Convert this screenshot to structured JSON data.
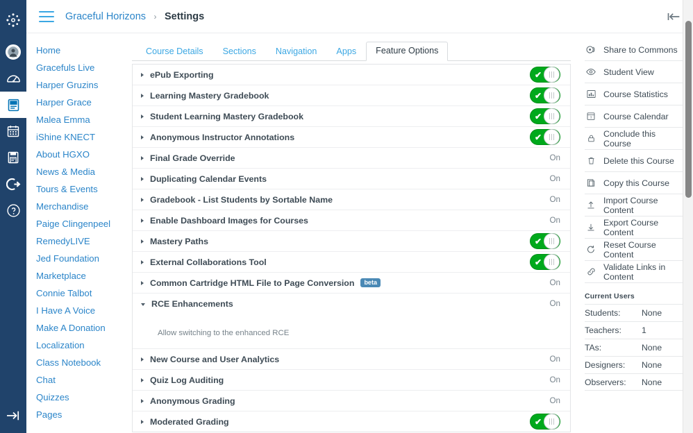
{
  "global_nav": {
    "items": [
      {
        "name": "canvas-logo",
        "icon": "canvas-logo-icon",
        "label": "Canvas",
        "active": false
      },
      {
        "name": "account",
        "icon": "avatar-icon",
        "label": "Account",
        "active": false
      },
      {
        "name": "dashboard",
        "icon": "dashboard-icon",
        "label": "Dashboard",
        "active": false
      },
      {
        "name": "courses",
        "icon": "courses-book-icon",
        "label": "Courses",
        "active": true
      },
      {
        "name": "calendar",
        "icon": "calendar-icon",
        "label": "Calendar",
        "active": false
      },
      {
        "name": "inbox",
        "icon": "inbox-icon",
        "label": "Inbox",
        "active": false
      },
      {
        "name": "logout",
        "icon": "logout-arrow-icon",
        "label": "Logout",
        "active": false
      },
      {
        "name": "help",
        "icon": "question-circle-icon",
        "label": "Help",
        "active": false
      }
    ],
    "bottom_item": {
      "name": "expand-nav",
      "icon": "arrow-to-right-icon",
      "label": "Expand navigation"
    }
  },
  "header": {
    "menu_icon": "hamburger-menu-icon",
    "breadcrumb": {
      "course": "Graceful Horizons",
      "separator": "›",
      "current": "Settings"
    },
    "collapse_icon": "collapse-panel-icon",
    "collapse_glyph": "|←"
  },
  "course_nav": {
    "items": [
      "Home",
      "Gracefuls Live",
      "Harper Gruzins",
      "Harper Grace",
      "Malea Emma",
      "iShine KNECT",
      "About HGXO",
      "News & Media",
      "Tours & Events",
      "Merchandise",
      "Paige Clingenpeel",
      "RemedyLIVE",
      "Jed Foundation",
      "Marketplace",
      "Connie Talbot",
      "I Have A Voice",
      "Make A Donation",
      "Localization",
      "Class Notebook",
      "Chat",
      "Quizzes",
      "Pages"
    ]
  },
  "tabs": [
    {
      "label": "Course Details",
      "active": false
    },
    {
      "label": "Sections",
      "active": false
    },
    {
      "label": "Navigation",
      "active": false
    },
    {
      "label": "Apps",
      "active": false
    },
    {
      "label": "Feature Options",
      "active": true
    }
  ],
  "features": [
    {
      "name": "ePub Exporting",
      "control": "toggle",
      "state": "on",
      "expanded": false,
      "beta": false
    },
    {
      "name": "Learning Mastery Gradebook",
      "control": "toggle",
      "state": "on",
      "expanded": false,
      "beta": false
    },
    {
      "name": "Student Learning Mastery Gradebook",
      "control": "toggle",
      "state": "on",
      "expanded": false,
      "beta": false
    },
    {
      "name": "Anonymous Instructor Annotations",
      "control": "toggle",
      "state": "on",
      "expanded": false,
      "beta": false
    },
    {
      "name": "Final Grade Override",
      "control": "text",
      "state": "On",
      "expanded": false,
      "beta": false
    },
    {
      "name": "Duplicating Calendar Events",
      "control": "text",
      "state": "On",
      "expanded": false,
      "beta": false
    },
    {
      "name": "Gradebook - List Students by Sortable Name",
      "control": "text",
      "state": "On",
      "expanded": false,
      "beta": false
    },
    {
      "name": "Enable Dashboard Images for Courses",
      "control": "text",
      "state": "On",
      "expanded": false,
      "beta": false
    },
    {
      "name": "Mastery Paths",
      "control": "toggle",
      "state": "on",
      "expanded": false,
      "beta": false
    },
    {
      "name": "External Collaborations Tool",
      "control": "toggle",
      "state": "on",
      "expanded": false,
      "beta": false
    },
    {
      "name": "Common Cartridge HTML File to Page Conversion",
      "control": "text",
      "state": "On",
      "expanded": false,
      "beta": true,
      "beta_label": "beta"
    },
    {
      "name": "RCE Enhancements",
      "control": "text",
      "state": "On",
      "expanded": true,
      "beta": false,
      "description": "Allow switching to the enhanced RCE"
    },
    {
      "name": "New Course and User Analytics",
      "control": "text",
      "state": "On",
      "expanded": false,
      "beta": false
    },
    {
      "name": "Quiz Log Auditing",
      "control": "text",
      "state": "On",
      "expanded": false,
      "beta": false
    },
    {
      "name": "Anonymous Grading",
      "control": "text",
      "state": "On",
      "expanded": false,
      "beta": false
    },
    {
      "name": "Moderated Grading",
      "control": "toggle",
      "state": "on",
      "expanded": false,
      "beta": false
    }
  ],
  "sidebar": {
    "actions": [
      {
        "label": "Share to Commons",
        "icon": "commons-share-icon"
      },
      {
        "label": "Student View",
        "icon": "student-view-eye-icon"
      },
      {
        "label": "Course Statistics",
        "icon": "statistics-chart-icon"
      },
      {
        "label": "Course Calendar",
        "icon": "calendar-icon"
      },
      {
        "label": "Conclude this Course",
        "icon": "lock-icon"
      },
      {
        "label": "Delete this Course",
        "icon": "trash-icon"
      },
      {
        "label": "Copy this Course",
        "icon": "copy-icon"
      },
      {
        "label": "Import Course Content",
        "icon": "import-upload-icon"
      },
      {
        "label": "Export Course Content",
        "icon": "export-download-icon"
      },
      {
        "label": "Reset Course Content",
        "icon": "reset-refresh-icon"
      },
      {
        "label": "Validate Links in Content",
        "icon": "link-icon"
      }
    ],
    "current_users": {
      "title": "Current Users",
      "rows": [
        {
          "label": "Students:",
          "value": "None"
        },
        {
          "label": "Teachers:",
          "value": "1"
        },
        {
          "label": "TAs:",
          "value": "None"
        },
        {
          "label": "Designers:",
          "value": "None"
        },
        {
          "label": "Observers:",
          "value": "None"
        }
      ]
    }
  },
  "colors": {
    "global_nav_bg": "#20436B",
    "link_blue": "#2B85C9",
    "tab_blue": "#3BA7E3",
    "toggle_green": "#00A91C",
    "beta_badge": "#4A89B5",
    "text_dark": "#3E4B55"
  }
}
